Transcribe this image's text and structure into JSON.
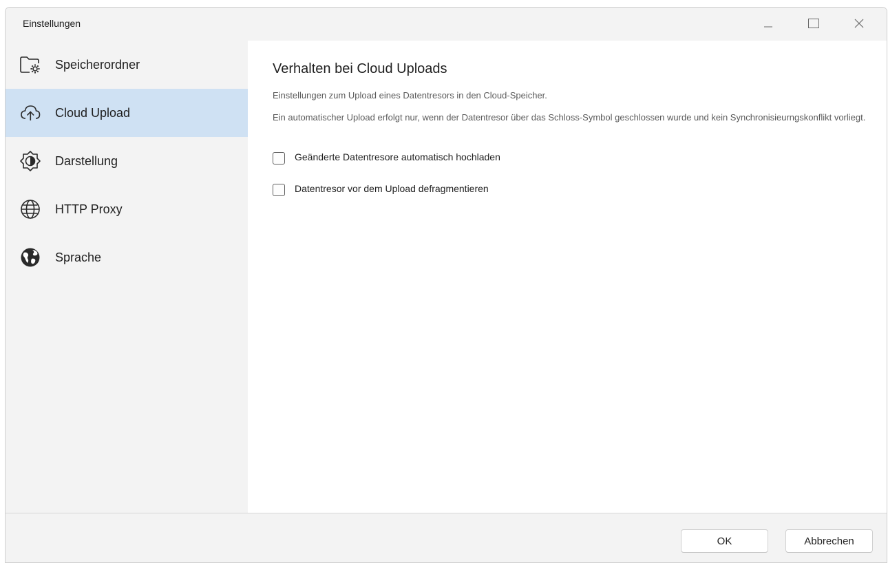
{
  "window": {
    "title": "Einstellungen"
  },
  "sidebar": {
    "items": [
      {
        "label": "Speicherordner",
        "icon": "folder-gear-icon",
        "active": false
      },
      {
        "label": "Cloud Upload",
        "icon": "cloud-upload-icon",
        "active": true
      },
      {
        "label": "Darstellung",
        "icon": "brightness-icon",
        "active": false
      },
      {
        "label": "HTTP Proxy",
        "icon": "globe-grid-icon",
        "active": false
      },
      {
        "label": "Sprache",
        "icon": "globe-filled-icon",
        "active": false
      }
    ]
  },
  "main": {
    "title": "Verhalten bei Cloud Uploads",
    "description1": "Einstellungen zum Upload eines Datentresors in den Cloud-Speicher.",
    "description2": "Ein automatischer Upload erfolgt nur, wenn der Datentresor über das Schloss-Symbol geschlossen wurde und kein Synchronisieurngskonflikt vorliegt.",
    "options": [
      {
        "label": "Geänderte Datentresore automatisch hochladen",
        "checked": false
      },
      {
        "label": "Datentresor vor dem Upload defragmentieren",
        "checked": false
      }
    ]
  },
  "footer": {
    "ok_label": "OK",
    "cancel_label": "Abbrechen"
  },
  "colors": {
    "sidebar_bg": "#f3f3f3",
    "active_item_bg": "#cfe1f3",
    "content_bg": "#ffffff"
  }
}
